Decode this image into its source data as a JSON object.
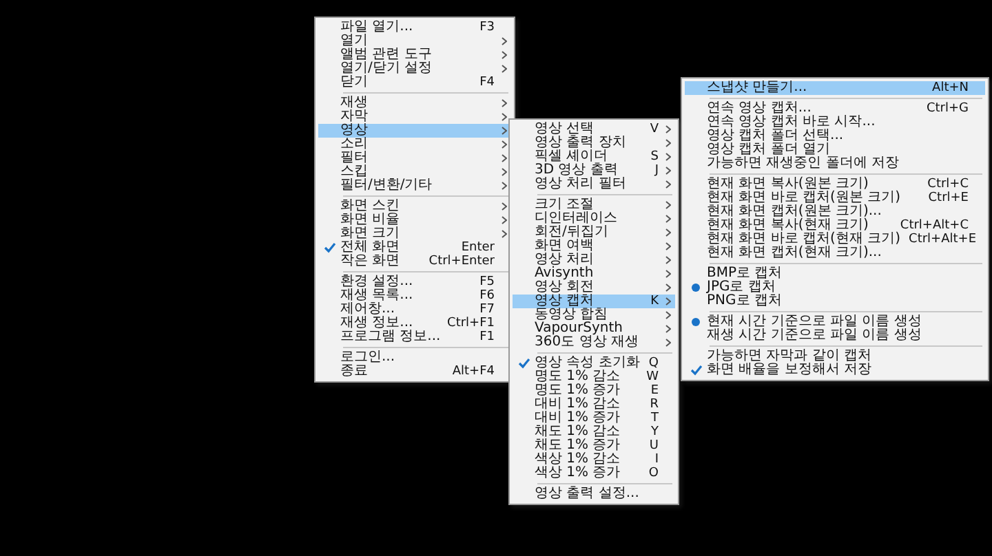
{
  "menus": [
    {
      "items": [
        {
          "kind": "item",
          "label": "파일 열기...",
          "shortcut": "F3",
          "submenu": false,
          "selected": false
        },
        {
          "kind": "item",
          "label": "열기",
          "submenu": true,
          "selected": false
        },
        {
          "kind": "item",
          "label": "앨범 관련 도구",
          "submenu": true,
          "selected": false
        },
        {
          "kind": "item",
          "label": "열기/닫기 설정",
          "submenu": true,
          "selected": false
        },
        {
          "kind": "item",
          "label": "닫기",
          "shortcut": "F4",
          "submenu": false,
          "selected": false
        },
        {
          "kind": "separator"
        },
        {
          "kind": "item",
          "label": "재생",
          "submenu": true,
          "selected": false
        },
        {
          "kind": "item",
          "label": "자막",
          "submenu": true,
          "selected": false
        },
        {
          "kind": "item",
          "label": "영상",
          "submenu": true,
          "selected": true
        },
        {
          "kind": "item",
          "label": "소리",
          "submenu": true,
          "selected": false
        },
        {
          "kind": "item",
          "label": "필터",
          "submenu": true,
          "selected": false
        },
        {
          "kind": "item",
          "label": "스킵",
          "submenu": true,
          "selected": false
        },
        {
          "kind": "item",
          "label": "필터/변환/기타",
          "submenu": true,
          "selected": false
        },
        {
          "kind": "separator"
        },
        {
          "kind": "item",
          "label": "화면 스킨",
          "submenu": true,
          "selected": false
        },
        {
          "kind": "item",
          "label": "화면 비율",
          "submenu": true,
          "selected": false
        },
        {
          "kind": "item",
          "label": "화면 크기",
          "submenu": true,
          "selected": false
        },
        {
          "kind": "check",
          "label": "전체 화면",
          "shortcut": "Enter",
          "checked": true,
          "submenu": false,
          "selected": false
        },
        {
          "kind": "check",
          "label": "작은 화면",
          "shortcut": "Ctrl+Enter",
          "checked": false,
          "submenu": false,
          "selected": false
        },
        {
          "kind": "separator"
        },
        {
          "kind": "item",
          "label": "환경 설정...",
          "shortcut": "F5",
          "submenu": false,
          "selected": false
        },
        {
          "kind": "item",
          "label": "재생 목록...",
          "shortcut": "F6",
          "submenu": false,
          "selected": false
        },
        {
          "kind": "item",
          "label": "제어창...",
          "shortcut": "F7",
          "submenu": false,
          "selected": false
        },
        {
          "kind": "item",
          "label": "재생 정보...",
          "shortcut": "Ctrl+F1",
          "submenu": false,
          "selected": false
        },
        {
          "kind": "item",
          "label": "프로그램 정보...",
          "shortcut": "F1",
          "submenu": false,
          "selected": false
        },
        {
          "kind": "separator"
        },
        {
          "kind": "item",
          "label": "로그인...",
          "submenu": false,
          "selected": false
        },
        {
          "kind": "item",
          "label": "종료",
          "shortcut": "Alt+F4",
          "submenu": false,
          "selected": false
        }
      ]
    },
    {
      "items": [
        {
          "kind": "item",
          "label": "영상 선택",
          "shortcut": "V",
          "submenu": true,
          "selected": false
        },
        {
          "kind": "item",
          "label": "영상 출력 장치",
          "submenu": true,
          "selected": false
        },
        {
          "kind": "item",
          "label": "픽셀 셰이더",
          "shortcut": "S",
          "submenu": true,
          "selected": false
        },
        {
          "kind": "item",
          "label": "3D 영상 출력",
          "shortcut": "J",
          "submenu": true,
          "selected": false
        },
        {
          "kind": "item",
          "label": "영상 처리 필터",
          "submenu": true,
          "selected": false
        },
        {
          "kind": "separator"
        },
        {
          "kind": "item",
          "label": "크기 조절",
          "submenu": true,
          "selected": false
        },
        {
          "kind": "item",
          "label": "디인터레이스",
          "submenu": true,
          "selected": false
        },
        {
          "kind": "item",
          "label": "회전/뒤집기",
          "submenu": true,
          "selected": false
        },
        {
          "kind": "item",
          "label": "화면 여백",
          "submenu": true,
          "selected": false
        },
        {
          "kind": "item",
          "label": "영상 처리",
          "submenu": true,
          "selected": false
        },
        {
          "kind": "item",
          "label": "Avisynth",
          "submenu": true,
          "selected": false
        },
        {
          "kind": "item",
          "label": "영상 회전",
          "submenu": true,
          "selected": false
        },
        {
          "kind": "item",
          "label": "영상 캡처",
          "shortcut": "K",
          "submenu": true,
          "selected": true
        },
        {
          "kind": "item",
          "label": "동영상 합침",
          "submenu": true,
          "selected": false
        },
        {
          "kind": "item",
          "label": "VapourSynth",
          "submenu": true,
          "selected": false
        },
        {
          "kind": "item",
          "label": "360도 영상 재생",
          "submenu": true,
          "selected": false
        },
        {
          "kind": "separator"
        },
        {
          "kind": "check",
          "label": "영상 속성 초기화",
          "shortcut": "Q",
          "checked": true,
          "submenu": false,
          "selected": false
        },
        {
          "kind": "item",
          "label": "명도 1% 감소",
          "shortcut": "W",
          "submenu": false,
          "selected": false
        },
        {
          "kind": "item",
          "label": "명도 1% 증가",
          "shortcut": "E",
          "submenu": false,
          "selected": false
        },
        {
          "kind": "item",
          "label": "대비 1% 감소",
          "shortcut": "R",
          "submenu": false,
          "selected": false
        },
        {
          "kind": "item",
          "label": "대비 1% 증가",
          "shortcut": "T",
          "submenu": false,
          "selected": false
        },
        {
          "kind": "item",
          "label": "채도 1% 감소",
          "shortcut": "Y",
          "submenu": false,
          "selected": false
        },
        {
          "kind": "item",
          "label": "채도 1% 증가",
          "shortcut": "U",
          "submenu": false,
          "selected": false
        },
        {
          "kind": "item",
          "label": "색상 1% 감소",
          "shortcut": "I",
          "submenu": false,
          "selected": false
        },
        {
          "kind": "item",
          "label": "색상 1% 증가",
          "shortcut": "O",
          "submenu": false,
          "selected": false
        },
        {
          "kind": "separator"
        },
        {
          "kind": "item",
          "label": "영상 출력 설정...",
          "submenu": false,
          "selected": false
        }
      ]
    },
    {
      "items": [
        {
          "kind": "item",
          "label": "스냅샷 만들기...",
          "shortcut": "Alt+N",
          "submenu": false,
          "selected": true
        },
        {
          "kind": "separator"
        },
        {
          "kind": "item",
          "label": "연속 영상 캡처...",
          "shortcut": "Ctrl+G",
          "submenu": false,
          "selected": false
        },
        {
          "kind": "item",
          "label": "연속 영상 캡처 바로 시작...",
          "submenu": false,
          "selected": false
        },
        {
          "kind": "item",
          "label": "영상 캡처 폴더 선택...",
          "submenu": false,
          "selected": false
        },
        {
          "kind": "item",
          "label": "영상 캡처 폴더 열기",
          "submenu": false,
          "selected": false
        },
        {
          "kind": "check",
          "label": "가능하면 재생중인 폴더에 저장",
          "checked": false,
          "submenu": false,
          "selected": false
        },
        {
          "kind": "separator"
        },
        {
          "kind": "item",
          "label": "현재 화면 복사(원본 크기)",
          "shortcut": "Ctrl+C",
          "submenu": false,
          "selected": false
        },
        {
          "kind": "item",
          "label": "현재 화면 바로 캡처(원본 크기)",
          "shortcut": "Ctrl+E",
          "submenu": false,
          "selected": false
        },
        {
          "kind": "item",
          "label": "현재 화면 캡처(원본 크기)...",
          "submenu": false,
          "selected": false
        },
        {
          "kind": "item",
          "label": "현재 화면 복사(현재 크기)",
          "shortcut": "Ctrl+Alt+C",
          "submenu": false,
          "selected": false
        },
        {
          "kind": "item",
          "label": "현재 화면 바로 캡처(현재 크기)",
          "shortcut": "Ctrl+Alt+E",
          "submenu": false,
          "selected": false
        },
        {
          "kind": "item",
          "label": "현재 화면 캡처(현재 크기)...",
          "submenu": false,
          "selected": false
        },
        {
          "kind": "separator"
        },
        {
          "kind": "radio",
          "label": "BMP로 캡처",
          "checked": false,
          "submenu": false,
          "selected": false
        },
        {
          "kind": "radio",
          "label": "JPG로 캡처",
          "checked": true,
          "submenu": false,
          "selected": false
        },
        {
          "kind": "radio",
          "label": "PNG로 캡처",
          "checked": false,
          "submenu": false,
          "selected": false
        },
        {
          "kind": "separator"
        },
        {
          "kind": "radio",
          "label": "현재 시간 기준으로 파일 이름 생성",
          "checked": true,
          "submenu": false,
          "selected": false
        },
        {
          "kind": "radio",
          "label": "재생 시간 기준으로 파일 이름 생성",
          "checked": false,
          "submenu": false,
          "selected": false
        },
        {
          "kind": "separator"
        },
        {
          "kind": "check",
          "label": "가능하면 자막과 같이 캡처",
          "checked": false,
          "submenu": false,
          "selected": false
        },
        {
          "kind": "check",
          "label": "화면 배율을 보정해서 저장",
          "checked": true,
          "submenu": false,
          "selected": false
        }
      ]
    }
  ]
}
